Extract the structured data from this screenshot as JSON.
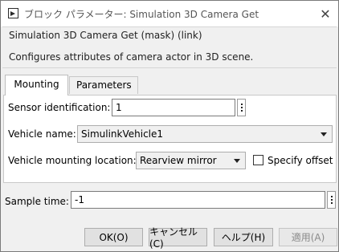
{
  "window": {
    "title": "ブロック パラメーター: Simulation 3D Camera Get",
    "close_glyph": "✕"
  },
  "header": {
    "title": "Simulation 3D Camera Get (mask) (link)",
    "description": "Configures attributes of camera actor in 3D scene."
  },
  "tabs": [
    {
      "label": "Mounting",
      "active": true
    },
    {
      "label": "Parameters",
      "active": false
    }
  ],
  "mounting": {
    "sensor_id_label": "Sensor identification:",
    "sensor_id_value": "1",
    "vehicle_name_label": "Vehicle name:",
    "vehicle_name_value": "SimulinkVehicle1",
    "mount_location_label": "Vehicle mounting location:",
    "mount_location_value": "Rearview mirror",
    "specify_offset_label": "Specify offset",
    "specify_offset_checked": false
  },
  "sample_time": {
    "label": "Sample time:",
    "value": "-1"
  },
  "buttons": {
    "ok": "OK(O)",
    "cancel": "キャンセル(C)",
    "help": "ヘルプ(H)",
    "apply": "適用(A)"
  },
  "icons": {
    "app": "simulink-block-icon",
    "close": "close-icon",
    "more": "vertical-ellipsis-icon",
    "dropdown": "chevron-down-icon"
  }
}
